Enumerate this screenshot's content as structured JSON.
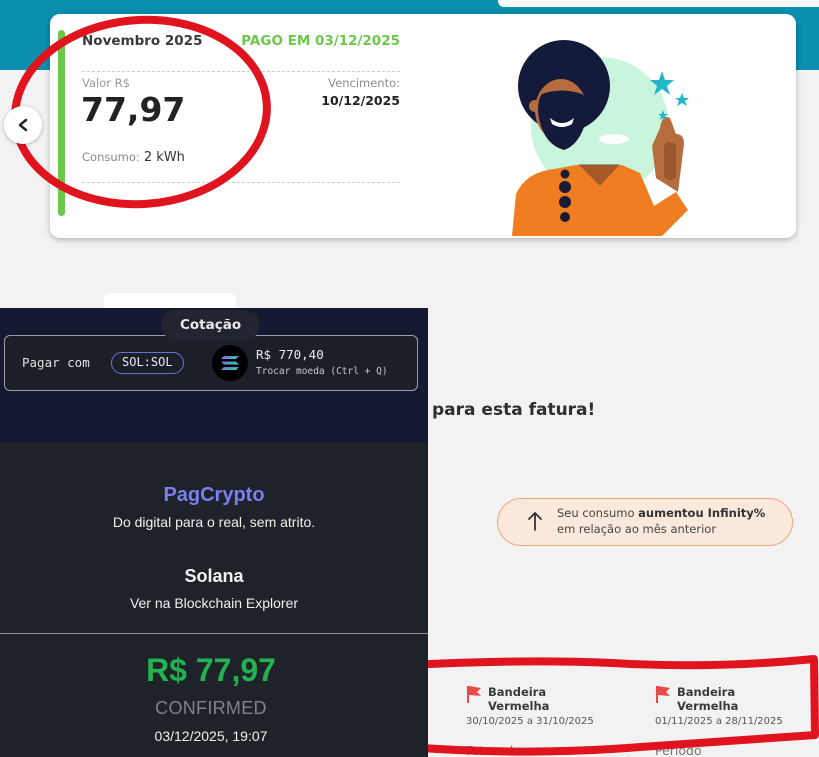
{
  "invoice": {
    "month": "Novembro 2025",
    "paid_status": "PAGO EM 03/12/2025",
    "value_label": "Valor R$",
    "value": "77,97",
    "consumption_label": "Consumo:",
    "consumption_value": "2 kWh",
    "due_label": "Vencimento:",
    "due_date": "10/12/2025"
  },
  "section_text": "para esta fatura!",
  "consumption_note": {
    "prefix": "Seu consumo ",
    "bold": "aumentou Infinity%",
    "suffix": "em relação ao mês anterior"
  },
  "flags": [
    {
      "title": "Bandeira Vermelha",
      "range": "30/10/2025 a 31/10/2025",
      "bottom": "Faturado a..."
    },
    {
      "title": "Bandeira Vermelha",
      "range": "01/11/2025 a 28/11/2025",
      "bottom": "Período"
    }
  ],
  "crypto_panel": {
    "quote_tab": "Cotação",
    "pay_with": "Pagar com",
    "coin": "SOL:SOL",
    "price": "R$ 770,40",
    "swap_hint": "Trocar moeda (Ctrl + Q)",
    "brand": "PagCrypto",
    "tagline": "Do digital para o real, sem atrito.",
    "chain": "Solana",
    "explorer_link": "Ver na Blockchain Explorer",
    "amount": "R$ 77,97",
    "status": "CONFIRMED",
    "timestamp": "03/12/2025, 19:07"
  },
  "colors": {
    "header_teal": "#0a8fae",
    "paid_green": "#6cc84a",
    "annotation_red": "#e0141e",
    "brand_purple": "#7b7ff2",
    "confirmed_green": "#23b24f",
    "flag_red": "#e84a4a"
  },
  "icons": [
    "chevron-left-icon",
    "arrow-up-icon",
    "flag-icon",
    "solana-logo-icon",
    "character-illustration"
  ]
}
